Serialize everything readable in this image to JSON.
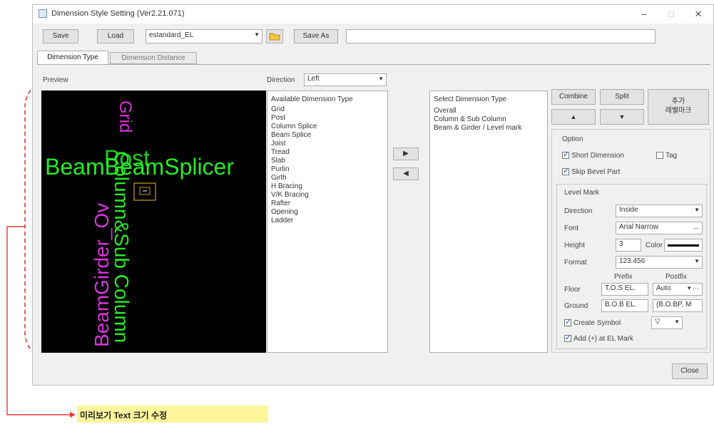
{
  "window": {
    "title": "Dimension Style Setting (Ver2.21.071)",
    "minimize": "–",
    "maximize": "□",
    "close": "✕"
  },
  "toolbar": {
    "save": "Save",
    "load": "Load",
    "style_value": "estandard_EL",
    "folder_icon": "folder-icon",
    "save_as": "Save As",
    "save_as_name": ""
  },
  "tabs": [
    {
      "label": "Dimension Type",
      "active": true
    },
    {
      "label": "Dimension Distance",
      "active": false
    }
  ],
  "preview": {
    "label": "Preview",
    "texts": {
      "beam": "BeamBeamSplicer",
      "post": "Post",
      "grid": "Grid",
      "column_splice": "Column&Sub Column",
      "girder": "BeamGirder_Ov"
    },
    "colors": {
      "green": "#22ee22",
      "magenta": "#dd33dd",
      "yellow": "#c9a227"
    }
  },
  "direction": {
    "label": "Direction",
    "value": "Left"
  },
  "available": {
    "header": "Available Dimension Type",
    "items": [
      "Grid",
      "Post",
      "Column Splice",
      "Beam Splice",
      "Joist",
      "Tread",
      "Slab",
      "Purlin",
      "Girth",
      "H Bracing",
      "V/K Bracing",
      "Rafter",
      "Opening",
      "Ladder"
    ]
  },
  "move_right": "▶",
  "move_left": "◀",
  "selected": {
    "header": "Select Dimension Type",
    "items": [
      "Overall",
      "Column & Sub Column",
      "Beam & Girder / Level mark"
    ]
  },
  "actions": {
    "combine": "Combine",
    "split": "Split",
    "up": "▲",
    "down": "▼",
    "add_level_mark": [
      "추가",
      "레벨마크"
    ]
  },
  "option": {
    "title": "Option",
    "short_dimension": {
      "label": "Short Dimension",
      "checked": true
    },
    "tag": {
      "label": "Tag",
      "checked": false
    },
    "skip_bevel": {
      "label": "Skip Bevel Part",
      "checked": true
    }
  },
  "level_mark": {
    "title": "Level Mark",
    "direction": {
      "label": "Direction",
      "value": "Inside"
    },
    "font": {
      "label": "Font",
      "value": "Arial Narrow",
      "browse": "..."
    },
    "height": {
      "label": "Height",
      "value": "3"
    },
    "color": {
      "label": "Color",
      "value": "#000000"
    },
    "format": {
      "label": "Format",
      "value": "123.456"
    },
    "prefix_header": "Prefix",
    "postfix_header": "Postfix",
    "floor": {
      "label": "Floor",
      "prefix": "T.O.S EL.",
      "postfix": "Auto"
    },
    "ground": {
      "label": "Ground",
      "prefix": "B.O.B EL.",
      "postfix": "(B.O.BP, M"
    },
    "create_symbol": {
      "label": "Create Symbol",
      "checked": true,
      "symbol": "▽"
    },
    "add_sign": {
      "label": "Add (+) at EL Mark",
      "checked": true
    }
  },
  "close_button": "Close",
  "annotation": {
    "text": "미리보기 Text 크기 수정",
    "color": "#e53935",
    "highlight": "#fff59d"
  }
}
